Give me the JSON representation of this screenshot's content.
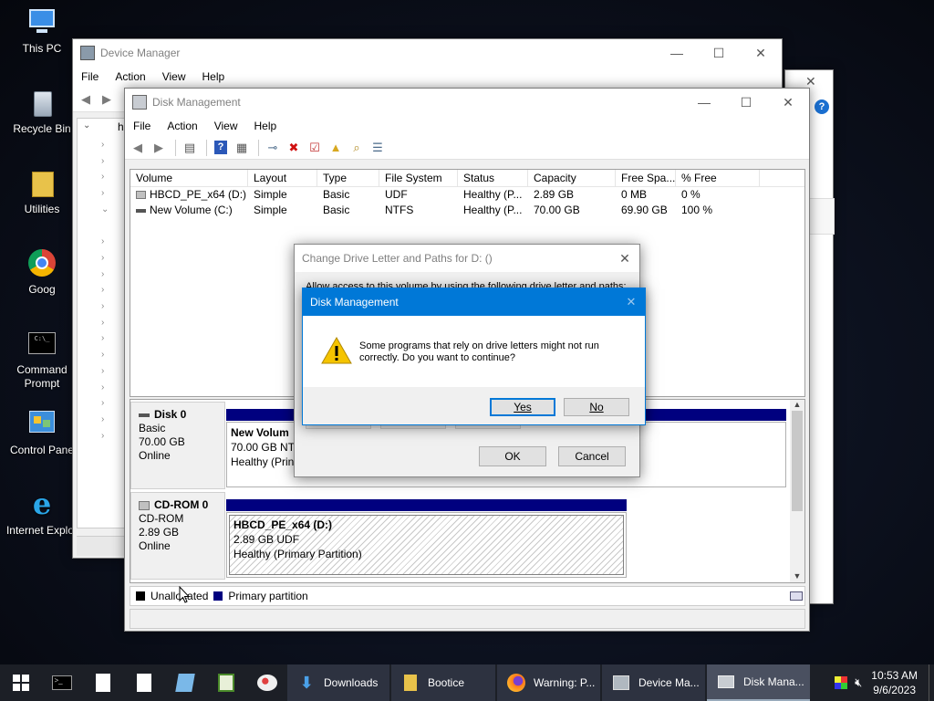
{
  "desktop": {
    "icons": [
      {
        "label": "This PC"
      },
      {
        "label": "Recycle Bin"
      },
      {
        "label": "Utilities"
      },
      {
        "label": "Goog"
      },
      {
        "label": "Command Prompt"
      },
      {
        "label": "Control Pane"
      },
      {
        "label": "Internet Explor"
      }
    ]
  },
  "device_manager": {
    "title": "Device Manager",
    "menu": [
      "File",
      "Action",
      "View",
      "Help"
    ],
    "tree_root": "h"
  },
  "disk_management": {
    "title": "Disk Management",
    "menu": [
      "File",
      "Action",
      "View",
      "Help"
    ],
    "columns": [
      "Volume",
      "Layout",
      "Type",
      "File System",
      "Status",
      "Capacity",
      "Free Spa...",
      "% Free"
    ],
    "rows": [
      [
        "HBCD_PE_x64 (D:)",
        "Simple",
        "Basic",
        "UDF",
        "Healthy (P...",
        "2.89 GB",
        "0 MB",
        "0 %"
      ],
      [
        "New Volume (C:)",
        "Simple",
        "Basic",
        "NTFS",
        "Healthy (P...",
        "70.00 GB",
        "69.90 GB",
        "100 %"
      ]
    ],
    "disks": [
      {
        "name": "Disk 0",
        "type": "Basic",
        "size": "70.00 GB",
        "status": "Online",
        "partition": {
          "name": "New Volum",
          "detail": "70.00 GB NTF",
          "health": "Healthy (Prin"
        }
      },
      {
        "name": "CD-ROM 0",
        "type": "CD-ROM",
        "size": "2.89 GB",
        "status": "Online",
        "partition": {
          "name": "HBCD_PE_x64  (D:)",
          "detail": "2.89 GB UDF",
          "health": "Healthy (Primary Partition)"
        }
      }
    ],
    "legend": {
      "unallocated": "Unallocated",
      "primary": "Primary partition"
    }
  },
  "change_dialog": {
    "title": "Change Drive Letter and Paths for D: ()",
    "text": "Allow access to this volume by using the following drive letter and paths:",
    "ok": "OK",
    "cancel": "Cancel"
  },
  "confirm_dialog": {
    "title": "Disk Management",
    "message_line1": "Some programs that rely on drive letters might not run",
    "message_line2": "correctly. Do you want to continue?",
    "yes": "Yes",
    "no": "No"
  },
  "taskbar": {
    "apps": [
      {
        "label": "Downloads"
      },
      {
        "label": "Bootice"
      },
      {
        "label": "Warning: P..."
      },
      {
        "label": "Device Ma..."
      },
      {
        "label": "Disk Mana..."
      }
    ],
    "time": "10:53 AM",
    "date": "9/6/2023"
  },
  "colors": {
    "primary_partition": "#00007f",
    "dialog_title": "#0078d7",
    "warning": "#f5c400"
  }
}
